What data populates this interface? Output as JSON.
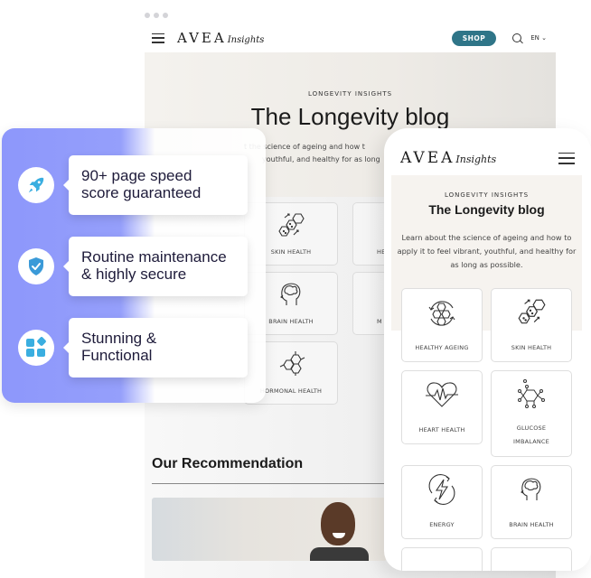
{
  "desktop": {
    "nav": {
      "brand": "AVEA",
      "brand_sub": "Insights",
      "shop_label": "SHOP",
      "language": "EN ⌄"
    },
    "hero": {
      "kicker": "LONGEVITY INSIGHTS",
      "title": "The Longevity blog",
      "desc_line1": "t the science of ageing and how t",
      "desc_line2": "youthful, and healthy for as long"
    },
    "categories": [
      {
        "label": "SKIN HEALTH",
        "icon": "skin-cells-icon"
      },
      {
        "label": "HE",
        "icon": "heart-icon"
      },
      {
        "label": "BRAIN HEALTH",
        "icon": "brain-head-icon"
      },
      {
        "label": "M",
        "icon": "molecule-icon"
      },
      {
        "label": "HORMONAL HEALTH",
        "icon": "hormone-molecule-icon"
      }
    ],
    "recommendation_title": "Our Recommendation"
  },
  "features": [
    {
      "icon": "rocket-icon",
      "line1": "90+ page speed",
      "line2": "score guaranteed"
    },
    {
      "icon": "shield-check-icon",
      "line1": "Routine maintenance",
      "line2": "& highly secure"
    },
    {
      "icon": "widgets-icon",
      "line1": "Stunning &",
      "line2": "Functional"
    }
  ],
  "mobile": {
    "nav": {
      "brand": "AVEA",
      "brand_sub": "Insights"
    },
    "hero": {
      "kicker": "LONGEVITY INSIGHTS",
      "title": "The Longevity blog",
      "desc": "Learn about the science of ageing and how to apply it to feel vibrant, youthful, and healthy for as long as possible."
    },
    "categories": [
      {
        "label": "HEALTHY AGEING",
        "icon": "healthy-ageing-icon"
      },
      {
        "label": "SKIN HEALTH",
        "icon": "skin-cells-icon"
      },
      {
        "label": "HEART HEALTH",
        "icon": "heart-pulse-icon"
      },
      {
        "label": "GLUCOSE",
        "label2": "IMBALANCE",
        "icon": "glucose-molecule-icon"
      },
      {
        "label": "ENERGY",
        "icon": "energy-icon"
      },
      {
        "label": "BRAIN HEALTH",
        "icon": "brain-head-icon"
      }
    ]
  },
  "colors": {
    "shop_button": "#2f7588",
    "feature_panel": "#8d97fb",
    "feature_icon": "#3aaee0",
    "mobile_hero_bg": "#f6f3ef"
  }
}
